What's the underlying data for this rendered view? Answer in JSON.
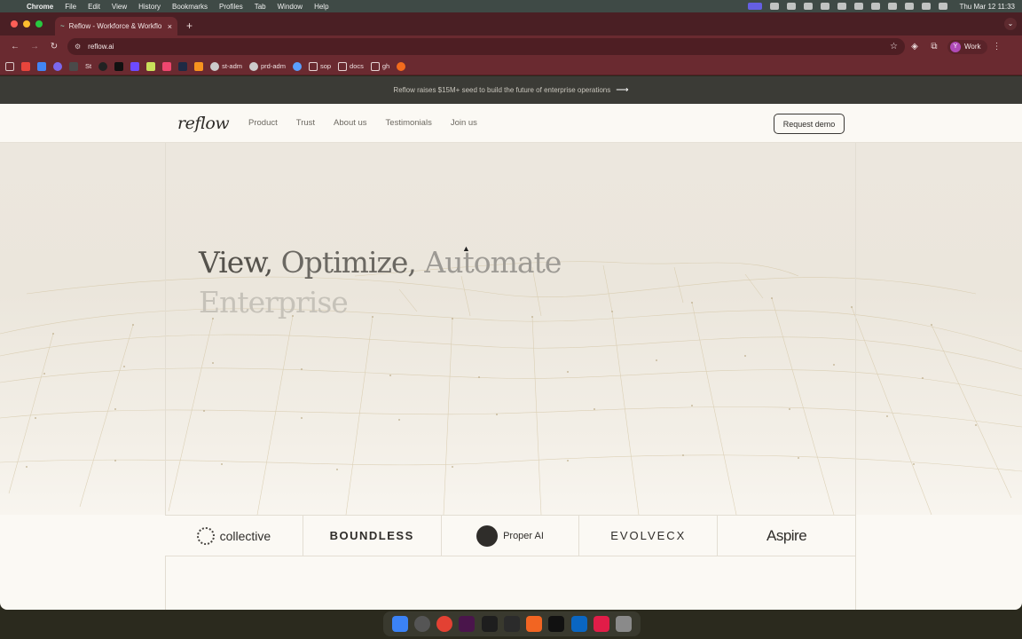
{
  "menubar": {
    "app_name": "Chrome",
    "items": [
      "File",
      "Edit",
      "View",
      "History",
      "Bookmarks",
      "Profiles",
      "Tab",
      "Window",
      "Help"
    ],
    "clock": "Thu Mar 12  11:33"
  },
  "browser": {
    "tab_title": "Reflow - Workforce & Workflo",
    "url": "reflow.ai",
    "profile_label": "Work",
    "profile_initial": "Y"
  },
  "bookmarks": {
    "items": [
      "St",
      "st-adm",
      "prd-adm",
      "sop",
      "docs",
      "gh"
    ]
  },
  "site": {
    "banner_text": "Reflow raises $15M+ seed to build the future of enterprise operations",
    "logo": "reflow",
    "nav": [
      "Product",
      "Trust",
      "About us",
      "Testimonials",
      "Join us"
    ],
    "cta": "Request demo",
    "headline": {
      "w1": "View,",
      "w2": "Optimize,",
      "w3": "Automate",
      "w4": "Enterprise"
    },
    "customers": [
      "collective",
      "BOUNDLESS",
      "Proper AI",
      "EVOLVECX",
      "Aspire"
    ]
  },
  "colors": {
    "tab_bar": "#4a1f24",
    "toolbar": "#6a2a30",
    "page_bg": "#fbf9f4",
    "hero_bg": "#ece7de",
    "banner_bg": "#3b3b36"
  }
}
